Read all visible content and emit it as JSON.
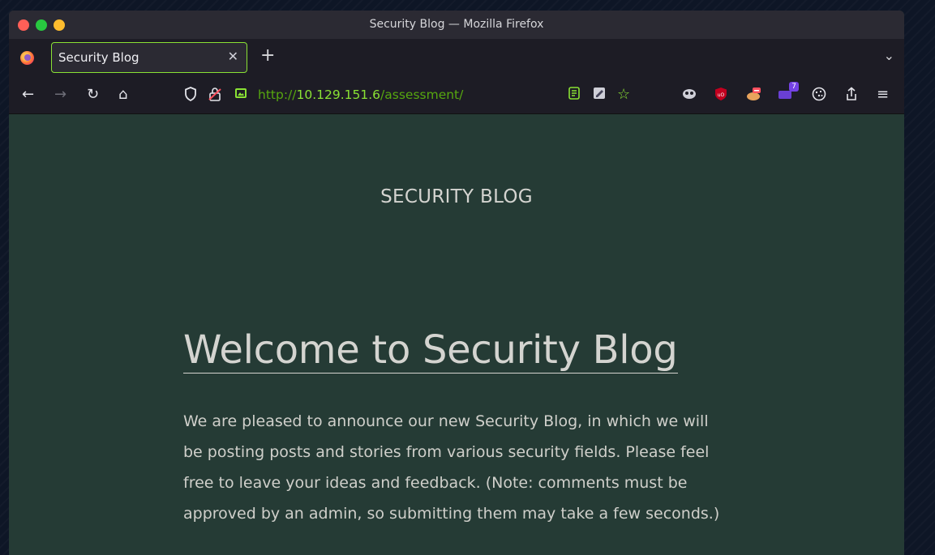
{
  "window": {
    "title": "Security Blog — Mozilla Firefox"
  },
  "tabs": [
    {
      "label": "Security Blog",
      "active": true
    }
  ],
  "toolbar": {
    "url_scheme": "http://",
    "url_host": "10.129.151.6",
    "url_path": "/assessment/",
    "extension_badge": "7"
  },
  "page": {
    "site_title": "SECURITY BLOG",
    "post": {
      "heading": "Welcome to Security Blog",
      "body_lines": [
        "We are pleased to announce our new Security Blog, in which we will",
        "be posting posts and stories from various security fields. Please feel",
        "free to leave your ideas and feedback. (Note: comments must be",
        "approved by an admin, so submitting them may take a few seconds.)"
      ]
    }
  },
  "colors": {
    "page_background": "#253b35",
    "browser_chrome": "#1d1c25",
    "active_tab_border": "#8ae234",
    "url_host": "#8ae234",
    "url_path": "#56a70f",
    "text": "#d4d4d0"
  },
  "icons": [
    "firefox-logo-icon",
    "close-icon",
    "plus-icon",
    "chevron-down-icon",
    "back-arrow-icon",
    "forward-arrow-icon",
    "reload-icon",
    "home-icon",
    "shield-icon",
    "insecure-lock-icon",
    "image-permission-icon",
    "reader-view-icon",
    "note-icon",
    "bookmark-star-icon",
    "extension-icons",
    "cookie-icon",
    "share-icon",
    "hamburger-menu-icon"
  ]
}
